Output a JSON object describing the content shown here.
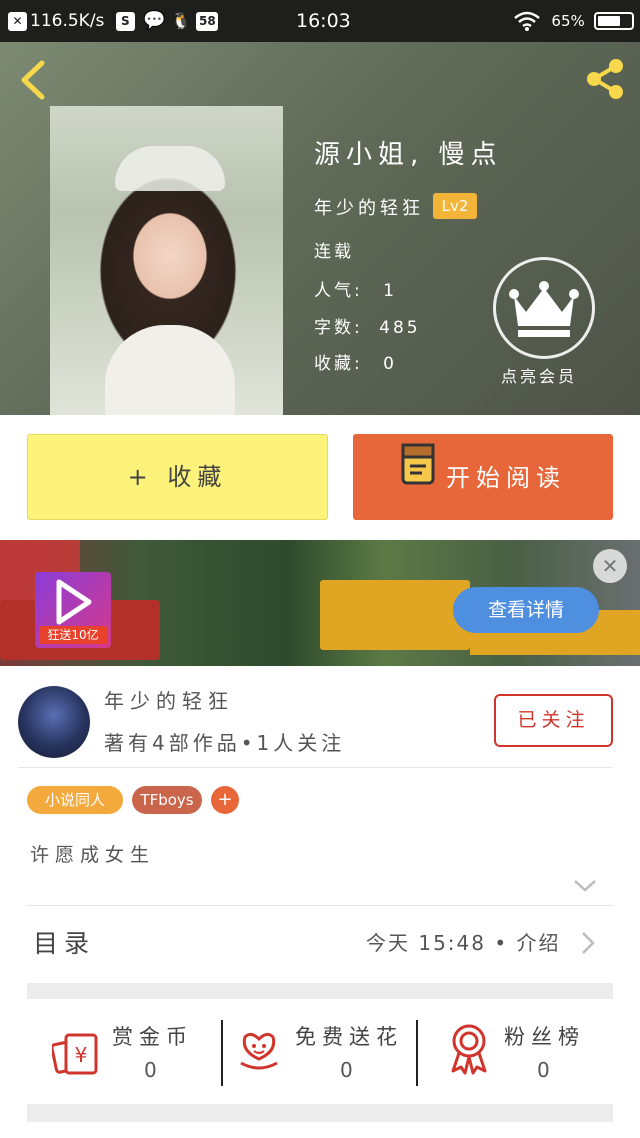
{
  "status_bar": {
    "net_speed": "116.5K/s",
    "notif_count": "58",
    "time": "16:03",
    "battery": "65%"
  },
  "book": {
    "title": "源小姐, 慢点",
    "author": "年少的轻狂",
    "level": "Lv2",
    "status": "连载",
    "popularity_label": "人气:",
    "popularity_value": "1",
    "words_label": "字数:",
    "words_value": "485",
    "collect_label": "收藏:",
    "collect_value": "0"
  },
  "vip": {
    "label": "点亮会员"
  },
  "actions": {
    "collect": "+ 收藏",
    "read": "开始阅读"
  },
  "ad": {
    "logo_text": "狂送10亿",
    "details_button": "查看详情"
  },
  "author_card": {
    "name": "年少的轻狂",
    "summary": "著有4部作品•1人关注",
    "follow_button": "已关注"
  },
  "tags": [
    "小说同人",
    "TFboys"
  ],
  "tag_add": "+",
  "description": "许愿成女生",
  "toc": {
    "title": "目录",
    "updated": "今天 15:48 • 介绍"
  },
  "stats": [
    {
      "label": "赏金币",
      "value": "0",
      "icon": "coin-reward-icon"
    },
    {
      "label": "免费送花",
      "value": "0",
      "icon": "flower-icon"
    },
    {
      "label": "粉丝榜",
      "value": "0",
      "icon": "medal-icon"
    }
  ],
  "colors": {
    "accent_orange": "#e8673a",
    "collect_yellow": "#fdf37a",
    "tag_orange": "#f3a93c",
    "tag_brown": "#c9654a",
    "red": "#d0352c"
  }
}
